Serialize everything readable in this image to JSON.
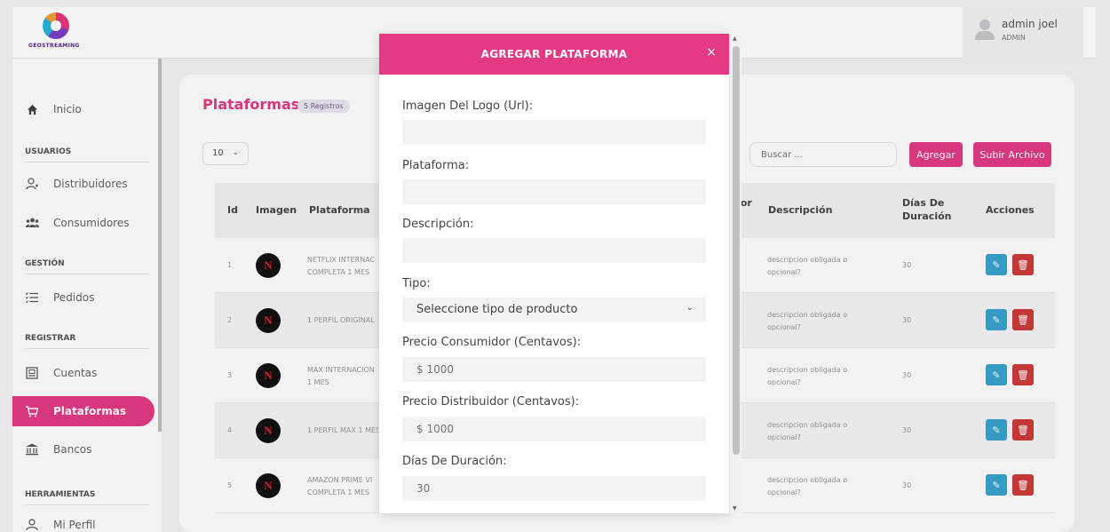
{
  "brand": {
    "logo_text": "GEOSTREAMING"
  },
  "user": {
    "name": "admin joel",
    "role": "ADMIN"
  },
  "sidebar": {
    "inicio": "Inicio",
    "sections": [
      "USUARIOS",
      "GESTIÓN",
      "REGISTRAR",
      "HERRAMIENTAS"
    ],
    "distribuidores": "Distribuidores",
    "consumidores": "Consumidores",
    "pedidos": "Pedidos",
    "cuentas": "Cuentas",
    "plataformas": "Plataformas",
    "bancos": "Bancos",
    "mi_perfil": "Mi Perfil"
  },
  "page": {
    "title": "Plataformas",
    "records_badge": "5 Registros",
    "page_length": "10",
    "search_placeholder": "Buscar ...",
    "add_button": "Agregar",
    "upload_button": "Subir Archivo"
  },
  "table": {
    "headers": {
      "id": "Id",
      "imagen": "Imagen",
      "plataforma": "Plataforma",
      "partial": "dor",
      "descripcion": "Descripción",
      "dias": "Días De Duración",
      "acciones": "Acciones"
    },
    "rows": [
      {
        "id": "1",
        "plataforma": "NETFLIX INTERNAC COMPLETA 1 MES",
        "descripcion": "descripcion obligada o opcional?",
        "dias": "30"
      },
      {
        "id": "2",
        "plataforma": "1 PERFIL ORIGINAL",
        "descripcion": "descripcion obligada o opcional?",
        "dias": "30"
      },
      {
        "id": "3",
        "plataforma": "MAX INTERNACION 1 MES",
        "descripcion": "descripcion obligada o opcional?",
        "dias": "30"
      },
      {
        "id": "4",
        "plataforma": "1 PERFIL MAX 1 MES",
        "descripcion": "descripcion obligada o opcional?",
        "dias": "30"
      },
      {
        "id": "5",
        "plataforma": "AMAZON PRIME VI COMPLETA 1 MES",
        "descripcion": "descripcion obligada o opcional?",
        "dias": "30"
      }
    ],
    "logo_letter": "N"
  },
  "modal": {
    "title": "AGREGAR PLATAFORMA",
    "close": "×",
    "logo_label": "Imagen Del Logo (Url):",
    "platform_label": "Plataforma:",
    "description_label": "Descripción:",
    "type_label": "Tipo:",
    "type_selected": "Seleccione tipo de producto",
    "price_consumer_label": "Precio Consumidor (Centavos):",
    "price_consumer_placeholder": "$ 1000",
    "price_distributor_label": "Precio Distribuidor (Centavos):",
    "price_distributor_placeholder": "$ 1000",
    "days_label": "Días De Duración:",
    "days_placeholder": "30"
  },
  "colors": {
    "accent": "#e33a83",
    "edit": "#3aa3cf",
    "delete": "#cf3a3a"
  },
  "icons": [
    "home-icon",
    "user-plus-icon",
    "users-icon",
    "list-icon",
    "account-icon",
    "cart-icon",
    "bank-icon",
    "user-icon",
    "pencil-icon",
    "trash-icon",
    "close-icon",
    "chevron-down-icon"
  ]
}
